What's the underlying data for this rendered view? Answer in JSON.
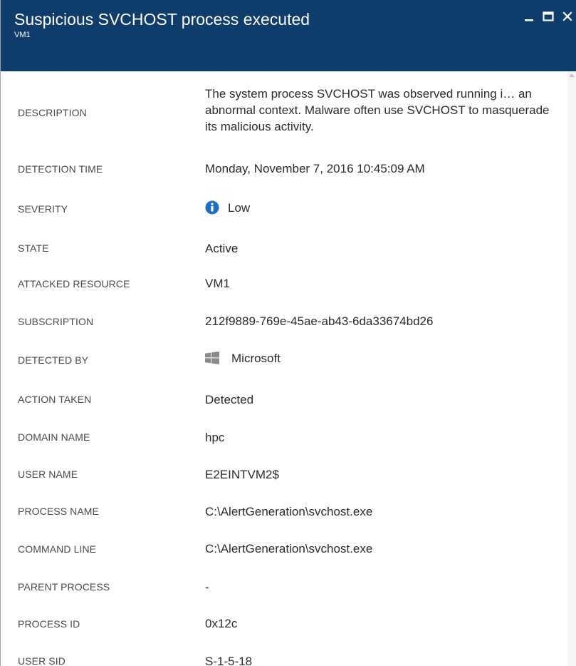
{
  "header": {
    "title": "Suspicious SVCHOST process executed",
    "subtitle": "VM1",
    "background": "#0f3d6b",
    "controls": [
      "minimize-icon",
      "maximize-icon",
      "close-icon"
    ]
  },
  "description": {
    "label": "DESCRIPTION",
    "value": "The system process SVCHOST was observed running i… an abnormal context. Malware often use SVCHOST to masquerade its malicious activity."
  },
  "fields": {
    "detection_time": {
      "label": "DETECTION TIME",
      "value": "Monday, November 7, 2016 10:45:09 AM"
    },
    "severity": {
      "label": "SEVERITY",
      "value": "Low",
      "icon": "info-icon",
      "icon_color": "#1b6ec2"
    },
    "state": {
      "label": "STATE",
      "value": "Active"
    },
    "attacked_resource": {
      "label": "ATTACKED RESOURCE",
      "value": "VM1"
    },
    "subscription": {
      "label": "SUBSCRIPTION",
      "value": "212f9889-769e-45ae-ab43-6da33674bd26"
    },
    "detected_by": {
      "label": "DETECTED BY",
      "value": "Microsoft",
      "icon": "windows-logo-icon",
      "icon_color": "#8a8a8a"
    },
    "action_taken": {
      "label": "ACTION TAKEN",
      "value": "Detected"
    },
    "domain_name": {
      "label": "DOMAIN NAME",
      "value": "hpc"
    },
    "user_name": {
      "label": "USER NAME",
      "value": "E2EINTVM2$"
    },
    "process_name": {
      "label": "PROCESS NAME",
      "value": "C:\\AlertGeneration\\svchost.exe"
    },
    "command_line": {
      "label": "COMMAND LINE",
      "value": "C:\\AlertGeneration\\svchost.exe"
    },
    "parent_process": {
      "label": "PARENT PROCESS",
      "value": "-"
    },
    "process_id": {
      "label": "PROCESS ID",
      "value": "0x12c"
    },
    "user_sid": {
      "label": "USER SID",
      "value": "S-1-5-18"
    }
  }
}
